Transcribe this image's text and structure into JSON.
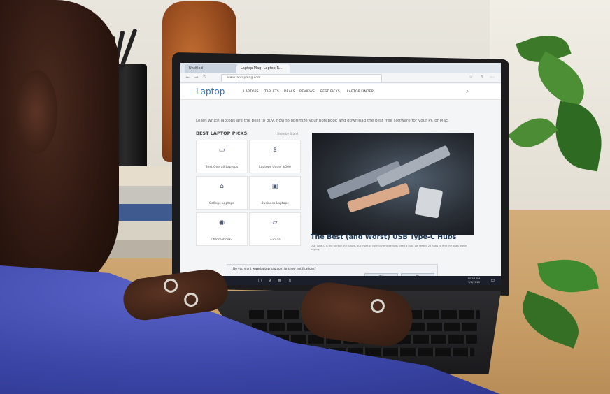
{
  "browser": {
    "tabs": [
      {
        "label": "Untitled"
      },
      {
        "label": "Laptop Mag: Laptop R..."
      }
    ],
    "address": "www.laptopmag.com"
  },
  "site": {
    "logo": "Laptop",
    "nav": [
      "LAPTOPS",
      "TABLETS",
      "DEALS",
      "REVIEWS",
      "BEST PICKS",
      "LAPTOP FINDER"
    ],
    "tagline": "Learn which laptops are the best to buy, how to optimize your notebook and download the best free software for your PC or Mac.",
    "picks_title": "BEST LAPTOP PICKS",
    "picks_more": "Show by Brand",
    "picks": [
      {
        "label": "Best Overall Laptops",
        "icon": "laptop-icon"
      },
      {
        "label": "Laptops Under $500",
        "icon": "dollar-icon"
      },
      {
        "label": "College Laptops",
        "icon": "graduation-cap-icon"
      },
      {
        "label": "Business Laptops",
        "icon": "briefcase-icon"
      },
      {
        "label": "Chromebooks",
        "icon": "chrome-icon"
      },
      {
        "label": "2-in-1s",
        "icon": "convertible-icon"
      }
    ],
    "headline": "The Best (and Worst) USB Type-C Hubs",
    "blurb": "USB Type-C is the port of the future, but most of your current devices need a hub. We tested 25 hubs to find the ones worth buying.",
    "links": [
      "Best USB Hubs",
      "Best laptop deals 2019",
      "Best PCs in 2019"
    ]
  },
  "notification": {
    "text": "Do you want www.laptopmag.com to show notifications?",
    "yes": "Yes",
    "no": "No"
  },
  "taskbar": {
    "time": "10:57 PM",
    "date": "1/3/2019"
  },
  "colors": {
    "brand": "#2f73b8",
    "sweater": "#3b45a6",
    "desk": "#c79d66"
  }
}
